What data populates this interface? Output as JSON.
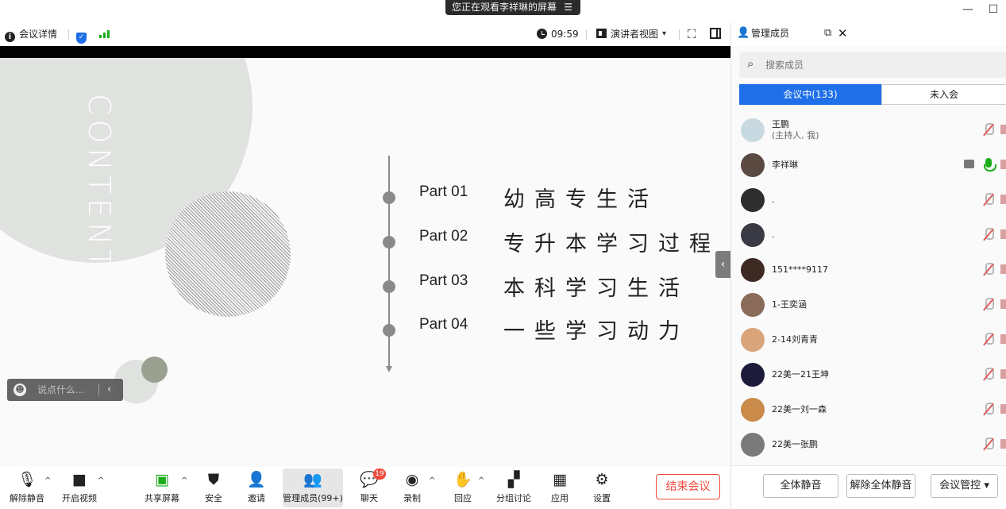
{
  "banner": {
    "sharing_text": "您正在观看李祥琳的屏幕",
    "sharing_icon": "list-icon"
  },
  "window": {
    "minimize": "—",
    "maximize": "☐"
  },
  "toolbar": {
    "info_label": "会议详情",
    "time": "09:59",
    "view_label": "演讲者视图",
    "view_caret": "▾",
    "fullscreen_glyph": "⛶"
  },
  "slide": {
    "vertical_title": "CONTENT",
    "agenda": [
      {
        "part": "Part 01",
        "title": "幼高专生活"
      },
      {
        "part": "Part 02",
        "title": "专升本学习过程"
      },
      {
        "part": "Part 03",
        "title": "本科学习生活"
      },
      {
        "part": "Part 04",
        "title": "一些学习动力"
      }
    ]
  },
  "chat_input": {
    "placeholder": "说点什么...",
    "collapse": "‹"
  },
  "side_handle": "‹",
  "controls": {
    "unmute": "解除静音",
    "video": "开启视频",
    "share_screen": "共享屏幕",
    "security": "安全",
    "invite": "邀请",
    "members": "管理成员(99+)",
    "chat": "聊天",
    "chat_badge": "19",
    "record": "录制",
    "reaction": "回应",
    "breakout": "分组讨论",
    "apps": "应用",
    "settings": "设置",
    "end_meeting": "结束会议"
  },
  "panel": {
    "title": "管理成员",
    "search_placeholder": "搜索成员",
    "tab_in_meeting": "会议中(133)",
    "tab_not_joined": "未入会",
    "members": [
      {
        "name": "王鹏",
        "sub": "(主持人, 我)",
        "avatar_color": "#c9d9e2",
        "mic": "off"
      },
      {
        "name": "李祥琳",
        "sub": "",
        "avatar_color": "#5b4a42",
        "mic": "on"
      },
      {
        "name": ".",
        "sub": "",
        "avatar_color": "#2e2e2e",
        "mic": "off"
      },
      {
        "name": ".",
        "sub": "",
        "avatar_color": "#3a3a44",
        "mic": "off"
      },
      {
        "name": "151****9117",
        "sub": "",
        "avatar_color": "#3d2a22",
        "mic": "off"
      },
      {
        "name": "1-王奕涵",
        "sub": "",
        "avatar_color": "#8a6b5a",
        "mic": "off"
      },
      {
        "name": "2-14刘青青",
        "sub": "",
        "avatar_color": "#d9a47a",
        "mic": "off"
      },
      {
        "name": "22美一21王坤",
        "sub": "",
        "avatar_color": "#1c1c3a",
        "mic": "off"
      },
      {
        "name": "22美一刘一森",
        "sub": "",
        "avatar_color": "#c98a4a",
        "mic": "off"
      },
      {
        "name": "22美一张鹏",
        "sub": "",
        "avatar_color": "#7a7a7a",
        "mic": "off"
      }
    ],
    "mute_all": "全体静音",
    "unmute_all": "解除全体静音",
    "meeting_control": "会议管控",
    "control_caret": "▾"
  },
  "colors": {
    "accent": "#1e6fe8",
    "danger": "#f04a3e",
    "signal": "#1aad19"
  }
}
